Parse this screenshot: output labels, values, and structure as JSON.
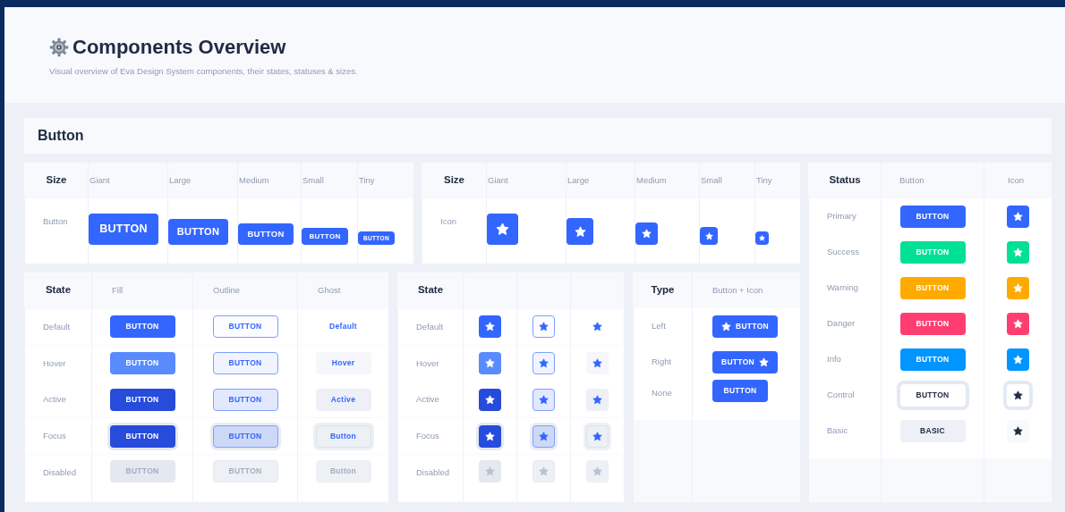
{
  "header": {
    "title": "Components Overview",
    "subtitle": "Visual overview of Eva Design System components, their states, statuses & sizes."
  },
  "section_title": "Button",
  "size_buttons": {
    "header": "Size",
    "columns": [
      "Giant",
      "Large",
      "Medium",
      "Small",
      "Tiny"
    ],
    "row_label": "Button",
    "buttons": [
      "BUTTON",
      "BUTTON",
      "BUTTON",
      "BUTTON",
      "BUTTON"
    ]
  },
  "size_icons": {
    "header": "Size",
    "columns": [
      "Giant",
      "Large",
      "Medium",
      "Small",
      "Tiny"
    ],
    "row_label": "Icon"
  },
  "states": {
    "header": "State",
    "columns": [
      "Fill",
      "Outline",
      "Ghost"
    ],
    "rows": [
      {
        "label": "Default",
        "kind": "default",
        "fill": "BUTTON",
        "outline": "BUTTON",
        "ghost": "Default"
      },
      {
        "label": "Hover",
        "kind": "hover",
        "fill": "BUTTON",
        "outline": "BUTTON",
        "ghost": "Hover"
      },
      {
        "label": "Active",
        "kind": "active",
        "fill": "BUTTON",
        "outline": "BUTTON",
        "ghost": "Active"
      },
      {
        "label": "Focus",
        "kind": "focus",
        "fill": "BUTTON",
        "outline": "BUTTON",
        "ghost": "Button"
      },
      {
        "label": "Disabled",
        "kind": "disabled",
        "fill": "BUTTON",
        "outline": "BUTTON",
        "ghost": "Button"
      }
    ]
  },
  "icon_states": {
    "header": "State",
    "rows": [
      {
        "label": "Default",
        "kind": "default"
      },
      {
        "label": "Hover",
        "kind": "hover"
      },
      {
        "label": "Active",
        "kind": "active"
      },
      {
        "label": "Focus",
        "kind": "focus"
      },
      {
        "label": "Disabled",
        "kind": "disabled"
      }
    ]
  },
  "types": {
    "header": "Type",
    "column": "Button + Icon",
    "rows": [
      {
        "label": "Left",
        "kind": "left",
        "button": "BUTTON"
      },
      {
        "label": "Right",
        "kind": "right",
        "button": "BUTTON"
      },
      {
        "label": "None",
        "kind": "none",
        "button": "BUTTON"
      }
    ]
  },
  "statuses": {
    "header": "Status",
    "columns": [
      "Button",
      "Icon"
    ],
    "rows": [
      {
        "label": "Primary",
        "kind": "primary",
        "button": "BUTTON"
      },
      {
        "label": "Success",
        "kind": "success",
        "button": "BUTTON"
      },
      {
        "label": "Warning",
        "kind": "warning",
        "button": "BUTTON"
      },
      {
        "label": "Danger",
        "kind": "danger",
        "button": "BUTTON"
      },
      {
        "label": "Info",
        "kind": "info",
        "button": "BUTTON"
      },
      {
        "label": "Control",
        "kind": "control",
        "button": "BUTTON"
      },
      {
        "label": "Basic",
        "kind": "basic",
        "button": "BASIC"
      }
    ]
  }
}
